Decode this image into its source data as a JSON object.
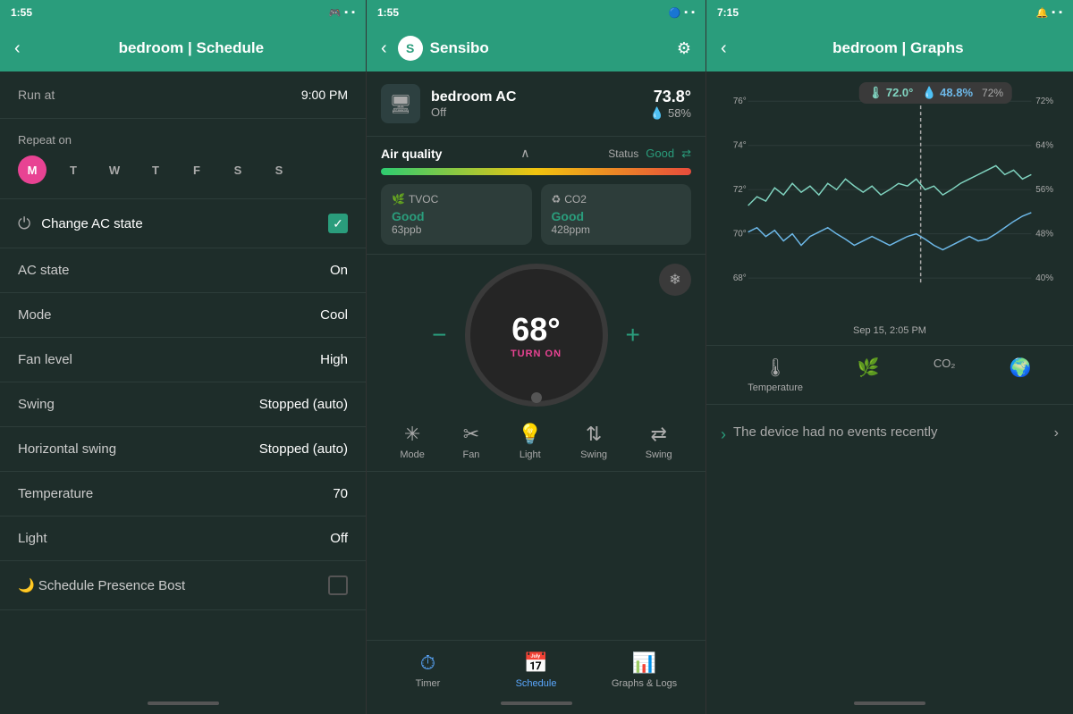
{
  "left_panel": {
    "status_bar": {
      "time": "1:55",
      "icons": "🎮 📷 ◼"
    },
    "header": {
      "title": "bedroom | Schedule",
      "back_label": "‹"
    },
    "run_at_label": "Run at",
    "run_at_value": "9:00 PM",
    "repeat_label": "Repeat on",
    "days": [
      {
        "label": "M",
        "active": true
      },
      {
        "label": "T",
        "active": false
      },
      {
        "label": "W",
        "active": false
      },
      {
        "label": "T",
        "active": false
      },
      {
        "label": "F",
        "active": false
      },
      {
        "label": "S",
        "active": false
      },
      {
        "label": "S",
        "active": false
      }
    ],
    "change_ac_label": "Change AC state",
    "settings": [
      {
        "label": "AC state",
        "value": "On"
      },
      {
        "label": "Mode",
        "value": "Cool"
      },
      {
        "label": "Fan level",
        "value": "High"
      },
      {
        "label": "Swing",
        "value": "Stopped (auto)"
      },
      {
        "label": "Horizontal swing",
        "value": "Stopped (auto)"
      },
      {
        "label": "Temperature",
        "value": "70"
      },
      {
        "label": "Light",
        "value": "Off"
      }
    ],
    "bottom_row_label": "Schedule Presence Bost"
  },
  "middle_panel": {
    "status_bar": {
      "time": "1:55",
      "icons": "🔵 📡 ◼"
    },
    "header": {
      "app_name": "Sensibo",
      "logo_letter": "S"
    },
    "device_name": "bedroom AC",
    "device_state": "Off",
    "temperature": "73.8°",
    "humidity": "58%",
    "air_quality_label": "Air quality",
    "status_label": "Status",
    "status_value": "Good",
    "tvoc_label": "TVOC",
    "tvoc_status": "Good",
    "tvoc_value": "63ppb",
    "co2_label": "CO2",
    "co2_status": "Good",
    "co2_value": "428ppm",
    "thermostat_temp": "68°",
    "thermostat_action": "TURN ON",
    "controls": [
      {
        "label": "Mode",
        "icon": "❄"
      },
      {
        "label": "Fan",
        "icon": "✂"
      },
      {
        "label": "Light",
        "icon": "💡"
      },
      {
        "label": "Swing",
        "icon": "⇅"
      },
      {
        "label": "Swing",
        "icon": "⇄"
      }
    ],
    "nav": [
      {
        "label": "Timer",
        "icon": "⏱",
        "active": false
      },
      {
        "label": "Schedule",
        "icon": "📅",
        "active": true
      },
      {
        "label": "Graphs & Logs",
        "icon": "📊",
        "active": false
      }
    ]
  },
  "right_panel": {
    "status_bar": {
      "time": "7:15",
      "icons": "🔔 📷 ◼"
    },
    "header": {
      "title": "bedroom | Graphs",
      "back_label": "‹"
    },
    "tooltip_temp": "🌡 72.0°",
    "tooltip_humid": "💧 48.8%",
    "tooltip_percent": "72%",
    "graph_y_labels": [
      "76°",
      "74°",
      "72°",
      "70°",
      "68°"
    ],
    "graph_y_right": [
      "72%",
      "64%",
      "56%",
      "48%",
      "40%"
    ],
    "timestamp": "Sep 15, 2:05 PM",
    "legend": [
      {
        "label": "Temperature",
        "icon": "🌡"
      },
      {
        "label": "",
        "icon": "🌿"
      },
      {
        "label": "CO₂",
        "icon": "CO₂"
      },
      {
        "label": "",
        "icon": "🌍"
      }
    ],
    "no_events_text": "The device had no events recently"
  }
}
